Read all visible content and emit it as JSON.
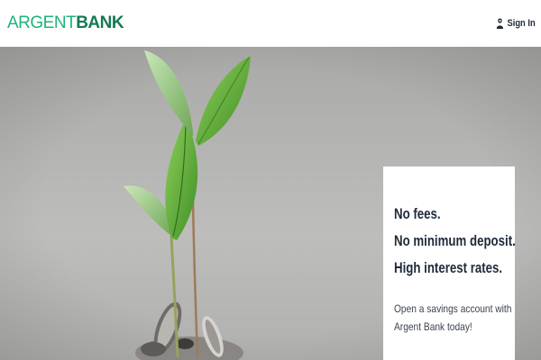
{
  "header": {
    "logo": {
      "part1": "ARGENT",
      "part2": "BANK"
    },
    "signin_label": "Sign In",
    "signin_icon": "person-icon"
  },
  "hero": {
    "image": "plant-sprout-on-coins",
    "promo": {
      "headline_lines": [
        "No fees.",
        "No minimum deposit.",
        "High interest rates."
      ],
      "body_lines": [
        "Open a savings account with",
        "Argent Bank today!"
      ]
    }
  },
  "colors": {
    "brand_light": "#1db47a",
    "brand_dark": "#137a50",
    "text_dark": "#1e2a3a",
    "hero_bg": "#b5b5b3"
  }
}
